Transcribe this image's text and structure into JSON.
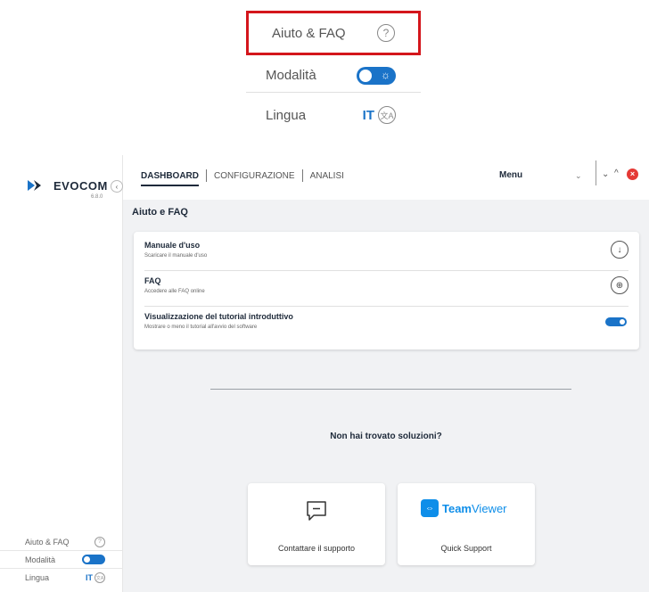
{
  "callout": {
    "help_label": "Aiuto & FAQ",
    "mode_label": "Modalità",
    "language_label": "Lingua",
    "language_code": "IT"
  },
  "sidebar": {
    "logo_text": "EVOCOM",
    "version": "6.8.0",
    "help_label": "Aiuto & FAQ",
    "mode_label": "Modalità",
    "language_label": "Lingua",
    "language_code": "IT"
  },
  "nav": {
    "tabs": [
      {
        "label": "DASHBOARD",
        "active": true
      },
      {
        "label": "CONFIGURAZIONE",
        "active": false
      },
      {
        "label": "ANALISI",
        "active": false
      }
    ],
    "menu_label": "Menu"
  },
  "page": {
    "title": "Aiuto e FAQ",
    "rows": [
      {
        "title": "Manuale d'uso",
        "subtitle": "Scaricare il manuale d'uso",
        "icon": "download-icon"
      },
      {
        "title": "FAQ",
        "subtitle": "Accedere alle FAQ online",
        "icon": "globe-icon"
      },
      {
        "title": "Visualizzazione del tutorial introduttivo",
        "subtitle": "Mostrare o meno il tutorial all'avvio del software",
        "icon": "toggle-switch"
      }
    ],
    "no_solution": "Non hai trovato soluzioni?",
    "tiles": [
      {
        "label": "Contattare il supporto",
        "icon": "chat-icon"
      },
      {
        "label": "Quick Support",
        "icon": "teamviewer-logo",
        "logo_bold": "Team",
        "logo_light": "Viewer"
      }
    ]
  },
  "colors": {
    "accent": "#1a73c8",
    "highlight": "#d4161c",
    "close": "#e53935",
    "teamviewer": "#0e8ee9"
  }
}
